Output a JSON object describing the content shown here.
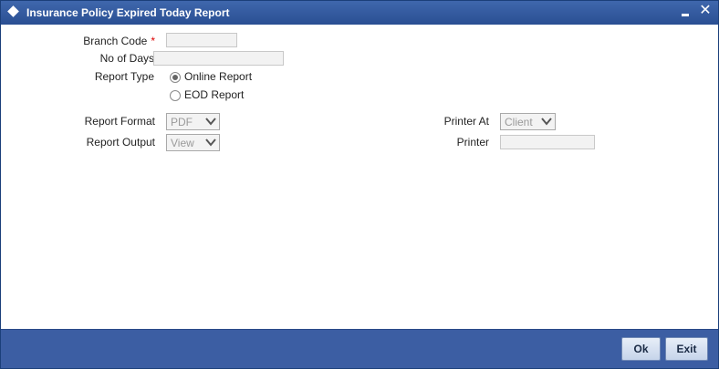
{
  "window": {
    "title": "Insurance Policy Expired Today Report"
  },
  "form": {
    "branch_code": {
      "label": "Branch Code",
      "required_mark": "*",
      "value": ""
    },
    "no_of_days": {
      "label": "No of Days",
      "value": ""
    },
    "report_type": {
      "label": "Report Type",
      "options": [
        {
          "label": "Online Report",
          "checked": true
        },
        {
          "label": "EOD Report",
          "checked": false
        }
      ]
    },
    "report_format": {
      "label": "Report Format",
      "value": "PDF"
    },
    "report_output": {
      "label": "Report Output",
      "value": "View"
    },
    "printer_at": {
      "label": "Printer At",
      "value": "Client"
    },
    "printer": {
      "label": "Printer",
      "value": ""
    }
  },
  "footer": {
    "ok_label": "Ok",
    "exit_label": "Exit"
  },
  "colors": {
    "titlebar": "#2f55a0",
    "footer": "#3c5ea3",
    "required": "#dd0000"
  }
}
